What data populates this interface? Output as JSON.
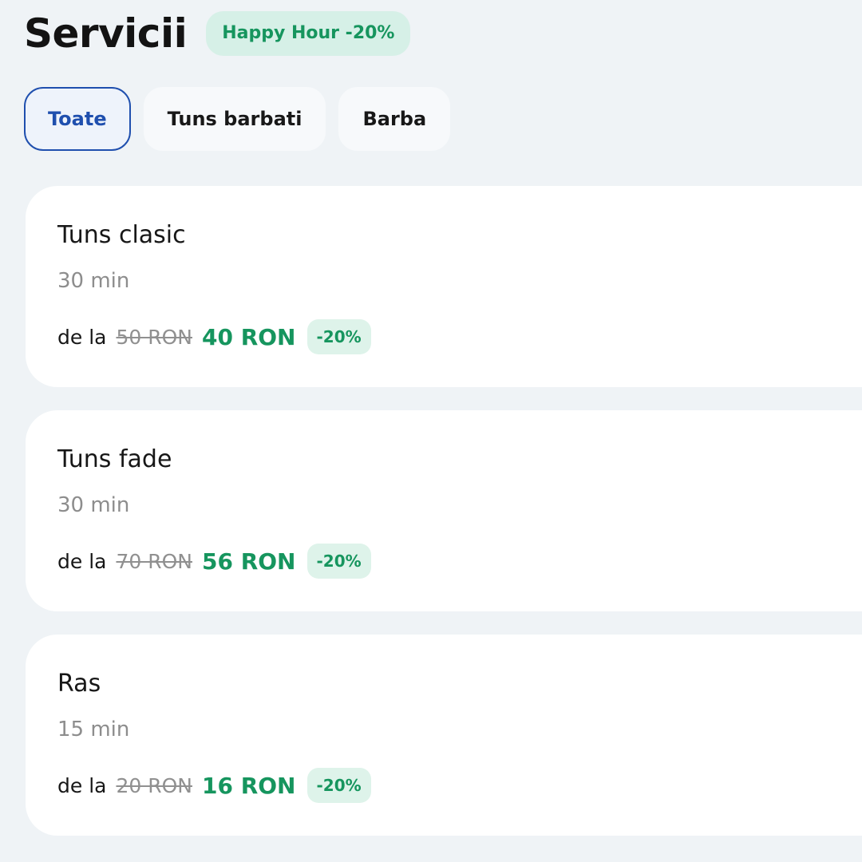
{
  "header": {
    "title": "Servicii",
    "promo_badge": "Happy Hour -20%"
  },
  "filters": [
    {
      "label": "Toate",
      "active": true
    },
    {
      "label": "Tuns barbati",
      "active": false
    },
    {
      "label": "Barba",
      "active": false
    }
  ],
  "services": [
    {
      "name": "Tuns clasic",
      "duration": "30 min",
      "price_prefix": "de la",
      "old_price": "50 RON",
      "new_price": "40 RON",
      "discount": "-20%"
    },
    {
      "name": "Tuns fade",
      "duration": "30 min",
      "price_prefix": "de la",
      "old_price": "70 RON",
      "new_price": "56 RON",
      "discount": "-20%"
    },
    {
      "name": "Ras",
      "duration": "15 min",
      "price_prefix": "de la",
      "old_price": "20 RON",
      "new_price": "16 RON",
      "discount": "-20%"
    }
  ],
  "colors": {
    "background": "#eff3f6",
    "accent_blue": "#1f4fae",
    "discount_green": "#16955e",
    "badge_green_bg": "#d6f0e7",
    "card_bg": "#ffffff"
  }
}
